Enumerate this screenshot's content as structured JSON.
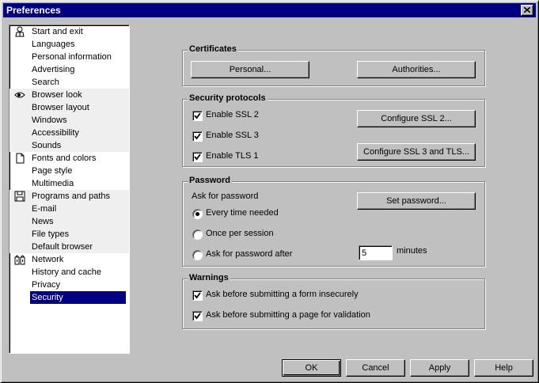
{
  "window": {
    "title": "Preferences"
  },
  "nav": {
    "groups": [
      {
        "icon": "person-icon",
        "items": [
          "Start and exit",
          "Languages",
          "Personal information",
          "Advertising",
          "Search"
        ]
      },
      {
        "icon": "eye-icon",
        "items": [
          "Browser look",
          "Browser layout",
          "Windows",
          "Accessibility",
          "Sounds"
        ]
      },
      {
        "icon": "document-icon",
        "items": [
          "Fonts and colors",
          "Page style",
          "Multimedia"
        ]
      },
      {
        "icon": "floppy-disk-icon",
        "items": [
          "Programs and paths",
          "E-mail",
          "News",
          "File types",
          "Default browser"
        ]
      },
      {
        "icon": "network-icon",
        "items": [
          "Network",
          "History and cache",
          "Privacy",
          "Security"
        ]
      }
    ],
    "selected": "Security"
  },
  "certificates": {
    "title": "Certificates",
    "personal_label": "Personal...",
    "authorities_label": "Authorities..."
  },
  "protocols": {
    "title": "Security protocols",
    "ssl2_label": "Enable SSL 2",
    "ssl3_label": "Enable SSL 3",
    "tls1_label": "Enable TLS 1",
    "ssl2_checked": true,
    "ssl3_checked": true,
    "tls1_checked": true,
    "configure_ssl2_label": "Configure SSL 2...",
    "configure_ssl3_tls_label": "Configure SSL 3 and TLS..."
  },
  "password": {
    "title": "Password",
    "ask_label": "Ask for password",
    "set_password_label": "Set password...",
    "options": [
      "Every time needed",
      "Once per session",
      "Ask for password after"
    ],
    "selected_index": 0,
    "minutes_value": "5",
    "minutes_label": "minutes"
  },
  "warnings": {
    "title": "Warnings",
    "form_label": "Ask before submitting a form insecurely",
    "validation_label": "Ask before submitting a page for validation",
    "form_checked": true,
    "validation_checked": true
  },
  "footer": {
    "ok_label": "OK",
    "cancel_label": "Cancel",
    "apply_label": "Apply",
    "help_label": "Help"
  }
}
